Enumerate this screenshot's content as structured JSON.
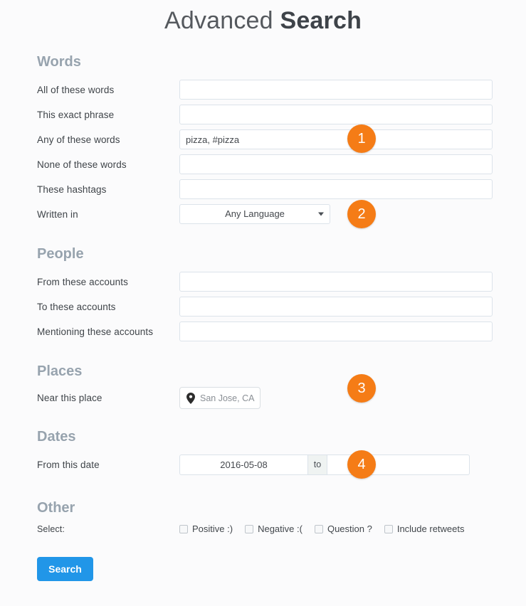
{
  "title": {
    "light": "Advanced ",
    "bold": "Search"
  },
  "sections": {
    "words": {
      "heading": "Words",
      "fields": {
        "all_words": {
          "label": "All of these words",
          "value": "",
          "placeholder": ""
        },
        "exact_phrase": {
          "label": "This exact phrase",
          "value": "",
          "placeholder": ""
        },
        "any_words": {
          "label": "Any of these words",
          "value": "pizza, #pizza",
          "placeholder": ""
        },
        "none_words": {
          "label": "None of these words",
          "value": "",
          "placeholder": ""
        },
        "hashtags": {
          "label": "These hashtags",
          "value": "",
          "placeholder": ""
        },
        "written_in": {
          "label": "Written in",
          "value": "Any Language",
          "caret_icon": "chevron-down-icon"
        }
      }
    },
    "people": {
      "heading": "People",
      "fields": {
        "from_accounts": {
          "label": "From these accounts",
          "value": "",
          "placeholder": ""
        },
        "to_accounts": {
          "label": "To these accounts",
          "value": "",
          "placeholder": ""
        },
        "mentioning_accounts": {
          "label": "Mentioning these accounts",
          "value": "",
          "placeholder": ""
        }
      }
    },
    "places": {
      "heading": "Places",
      "fields": {
        "near_place": {
          "label": "Near this place",
          "value": "San Jose, CA",
          "icon": "map-pin-icon"
        }
      }
    },
    "dates": {
      "heading": "Dates",
      "fields": {
        "from_date": {
          "label": "From this date",
          "value": "2016-05-08",
          "separator": "to",
          "to_value": "",
          "placeholder": ""
        }
      }
    },
    "other": {
      "heading": "Other",
      "select_label": "Select:",
      "checkboxes": [
        {
          "label": "Positive :)",
          "checked": false
        },
        {
          "label": "Negative :(",
          "checked": false
        },
        {
          "label": "Question ?",
          "checked": false
        },
        {
          "label": "Include retweets",
          "checked": false
        }
      ]
    }
  },
  "submit": {
    "label": "Search"
  },
  "badges": [
    {
      "number": "1"
    },
    {
      "number": "2"
    },
    {
      "number": "3"
    },
    {
      "number": "4"
    }
  ],
  "colors": {
    "badge_orange": "#f57c16",
    "button_blue": "#2196e8",
    "heading_grey": "#97a3ae",
    "input_border": "#dce3ea",
    "background": "#fbfbfc"
  }
}
